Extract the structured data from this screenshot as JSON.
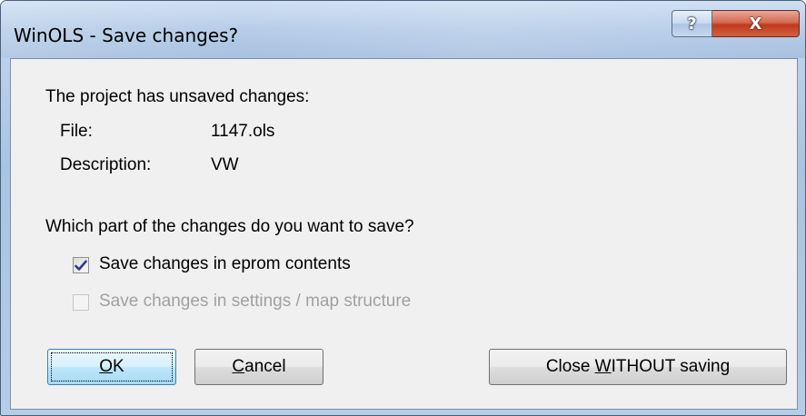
{
  "window": {
    "title": "WinOLS - Save changes?",
    "help_label": "?",
    "close_label": "X"
  },
  "dialog": {
    "intro": "The project has unsaved changes:",
    "file_label": "File:",
    "file_value": "1147.ols",
    "description_label": "Description:",
    "description_value": "VW",
    "question": "Which part of the changes do you want to save?",
    "options": [
      {
        "label": "Save changes in eprom contents",
        "checked": true,
        "enabled": true
      },
      {
        "label": "Save changes in settings / map structure",
        "checked": false,
        "enabled": false
      }
    ]
  },
  "buttons": {
    "ok": {
      "mnemonic": "O",
      "rest": "K"
    },
    "cancel": {
      "mnemonic": "C",
      "rest": "ancel"
    },
    "close_without_saving": {
      "before": "Close ",
      "mnemonic": "W",
      "rest": "ITHOUT saving"
    }
  },
  "colors": {
    "check_mark": "#2b3a8f",
    "default_button_border": "#3c7fb1",
    "close_button": "#c0391b"
  }
}
